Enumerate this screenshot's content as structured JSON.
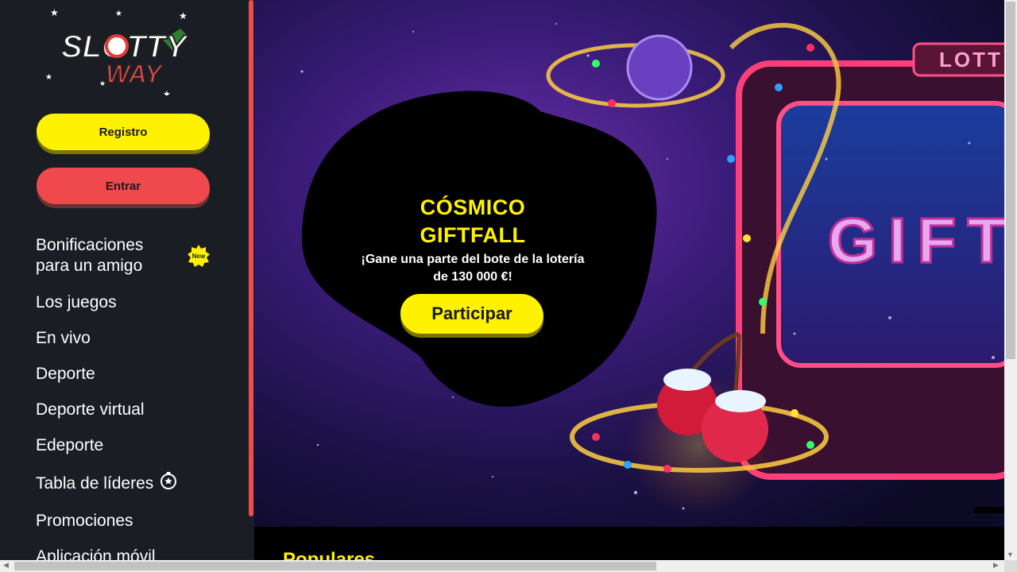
{
  "brand": {
    "logo_line1": "SLOTTY",
    "logo_line2": "WAY"
  },
  "auth": {
    "register_label": "Registro",
    "login_label": "Entrar"
  },
  "sidebar": {
    "items": [
      {
        "label": "Bonificaciones para un amigo",
        "badge": "New"
      },
      {
        "label": "Los juegos"
      },
      {
        "label": "En vivo"
      },
      {
        "label": "Deporte"
      },
      {
        "label": "Deporte virtual"
      },
      {
        "label": "Edeporte"
      },
      {
        "label": "Tabla de líderes",
        "icon": "trophy-icon"
      },
      {
        "label": "Promociones"
      },
      {
        "label": "Aplicación móvil"
      }
    ]
  },
  "banner": {
    "title_line1": "CÓSMICO",
    "title_line2": "GIFTFALL",
    "subtitle_line1": "¡Gane una parte del bote de la lotería",
    "subtitle_line2": "de 130 000 €!",
    "cta_label": "Participar",
    "sign_text": "GIFT",
    "top_sign_text": "LOTT"
  },
  "section": {
    "popular_title": "Populares"
  },
  "colors": {
    "accent_yellow": "#fff200",
    "accent_red": "#f0494d",
    "sidebar_bg": "#1b1d24"
  }
}
